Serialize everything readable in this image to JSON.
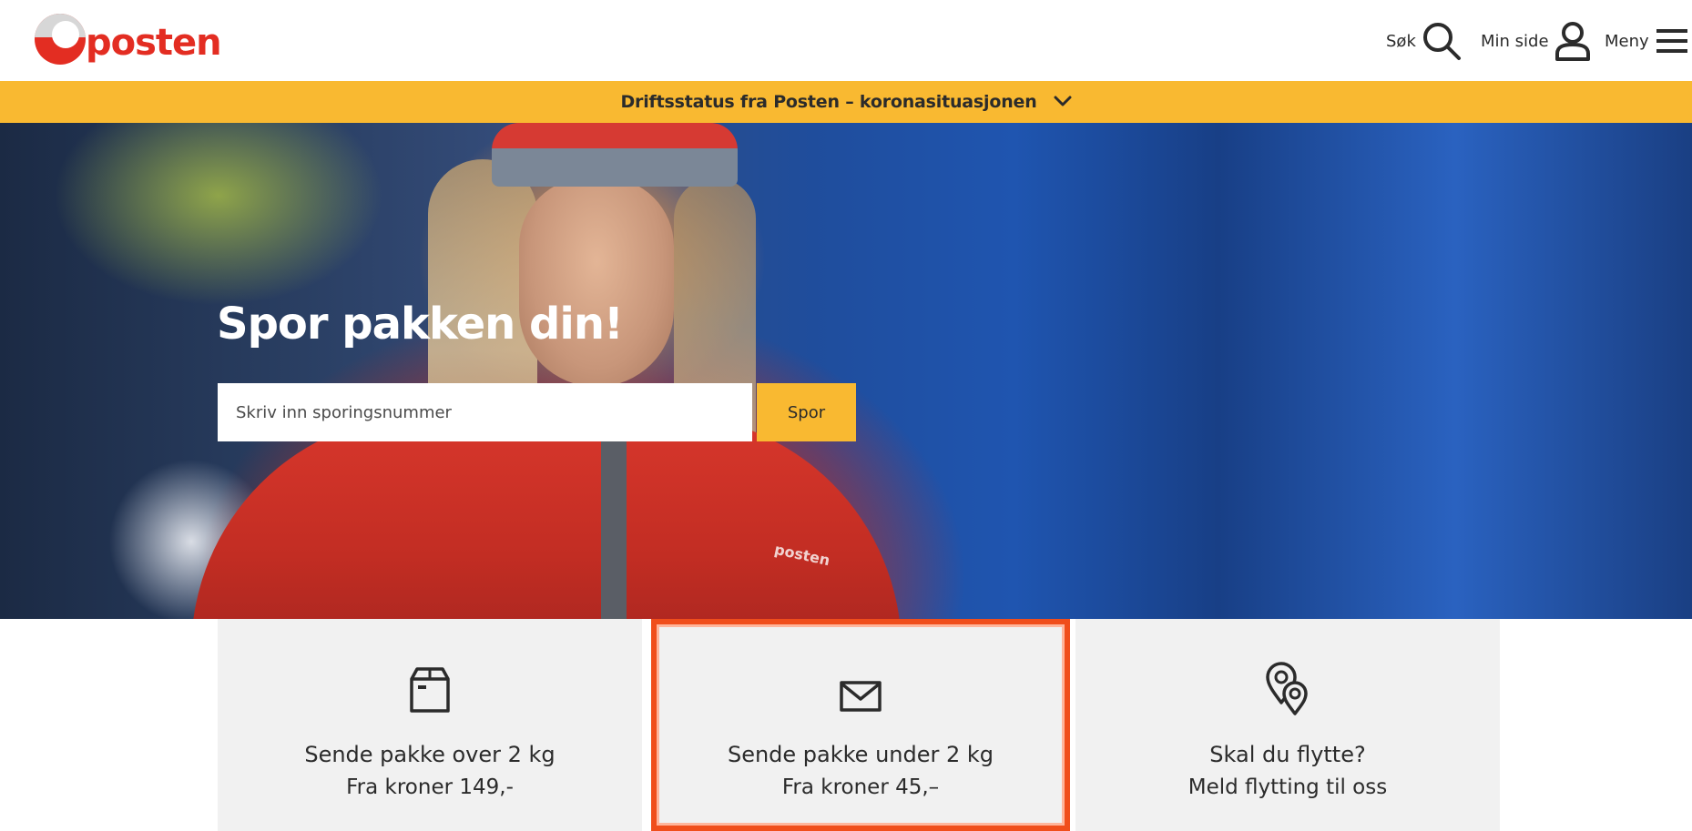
{
  "header": {
    "logo_text": "posten",
    "nav": [
      {
        "label": "Søk",
        "icon": "search-icon"
      },
      {
        "label": "Min side",
        "icon": "user-icon"
      },
      {
        "label": "Meny",
        "icon": "menu-icon"
      }
    ]
  },
  "status_bar": {
    "text": "Driftsstatus fra Posten – koronasituasjonen",
    "icon": "chevron-down-icon",
    "background": "#f9b931"
  },
  "hero": {
    "title": "Spor pakken din!",
    "input_placeholder": "Skriv inn sporingsnummer",
    "input_value": "",
    "button_label": "Spor",
    "jacket_text": "posten"
  },
  "cards": [
    {
      "icon": "package-icon",
      "title": "Sende pakke over 2 kg",
      "subtitle": "Fra kroner 149,-"
    },
    {
      "icon": "envelope-icon",
      "title": "Sende pakke under 2 kg",
      "subtitle": "Fra kroner 45,–",
      "highlighted": true,
      "highlight_color": "#f04e1b"
    },
    {
      "icon": "location-pins-icon",
      "title": "Skal du flytte?",
      "subtitle": "Meld flytting til oss"
    }
  ],
  "colors": {
    "brand_red": "#e32d22",
    "accent_yellow": "#f9b931",
    "card_bg": "#f1f1f1",
    "text": "#2b2b2b"
  }
}
